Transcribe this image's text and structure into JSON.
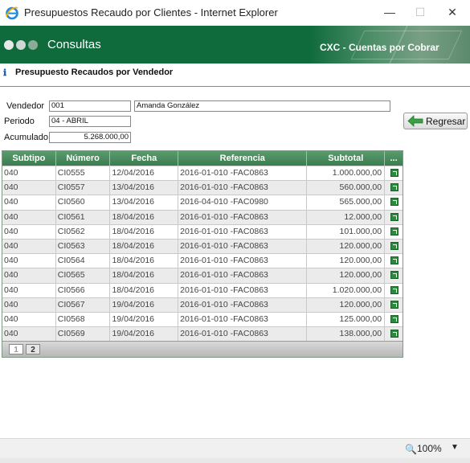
{
  "window": {
    "title": "Presupuestos Recaudo por Clientes - Internet Explorer",
    "minimize": "—",
    "maximize": "☐",
    "close": "✕"
  },
  "banner": {
    "title": "Consultas",
    "module": "CXC - Cuentas por Cobrar"
  },
  "section": {
    "icon": "info-icon",
    "title": "Presupuesto Recaudos por Vendedor"
  },
  "form": {
    "vendedor_label": "Vendedor",
    "vendedor_code": "001",
    "vendedor_name": "Amanda González",
    "periodo_label": "Periodo",
    "periodo_value": "04 - ABRIL",
    "acumulado_label": "Acumulado",
    "acumulado_value": "5.268.000,00"
  },
  "actions": {
    "back_label": "Regresar"
  },
  "grid": {
    "columns": [
      "Subtipo",
      "Número",
      "Fecha",
      "Referencia",
      "Subtotal",
      "..."
    ],
    "rows": [
      [
        "040",
        "CI0555",
        "12/04/2016",
        "2016-01-010 -FAC0863",
        "1.000.000,00"
      ],
      [
        "040",
        "CI0557",
        "13/04/2016",
        "2016-01-010 -FAC0863",
        "560.000,00"
      ],
      [
        "040",
        "CI0560",
        "13/04/2016",
        "2016-04-010 -FAC0980",
        "565.000,00"
      ],
      [
        "040",
        "CI0561",
        "18/04/2016",
        "2016-01-010 -FAC0863",
        "12.000,00"
      ],
      [
        "040",
        "CI0562",
        "18/04/2016",
        "2016-01-010 -FAC0863",
        "101.000,00"
      ],
      [
        "040",
        "CI0563",
        "18/04/2016",
        "2016-01-010 -FAC0863",
        "120.000,00"
      ],
      [
        "040",
        "CI0564",
        "18/04/2016",
        "2016-01-010 -FAC0863",
        "120.000,00"
      ],
      [
        "040",
        "CI0565",
        "18/04/2016",
        "2016-01-010 -FAC0863",
        "120.000,00"
      ],
      [
        "040",
        "CI0566",
        "18/04/2016",
        "2016-01-010 -FAC0863",
        "1.020.000,00"
      ],
      [
        "040",
        "CI0567",
        "19/04/2016",
        "2016-01-010 -FAC0863",
        "120.000,00"
      ],
      [
        "040",
        "CI0568",
        "19/04/2016",
        "2016-01-010 -FAC0863",
        "125.000,00"
      ],
      [
        "040",
        "CI0569",
        "19/04/2016",
        "2016-01-010 -FAC0863",
        "138.000,00"
      ]
    ],
    "pages": [
      "1",
      "2"
    ],
    "current_page": "1"
  },
  "status": {
    "zoom": "100%"
  },
  "colors": {
    "banner": "#0f6b3c",
    "grid_header": "#3b7d50"
  }
}
